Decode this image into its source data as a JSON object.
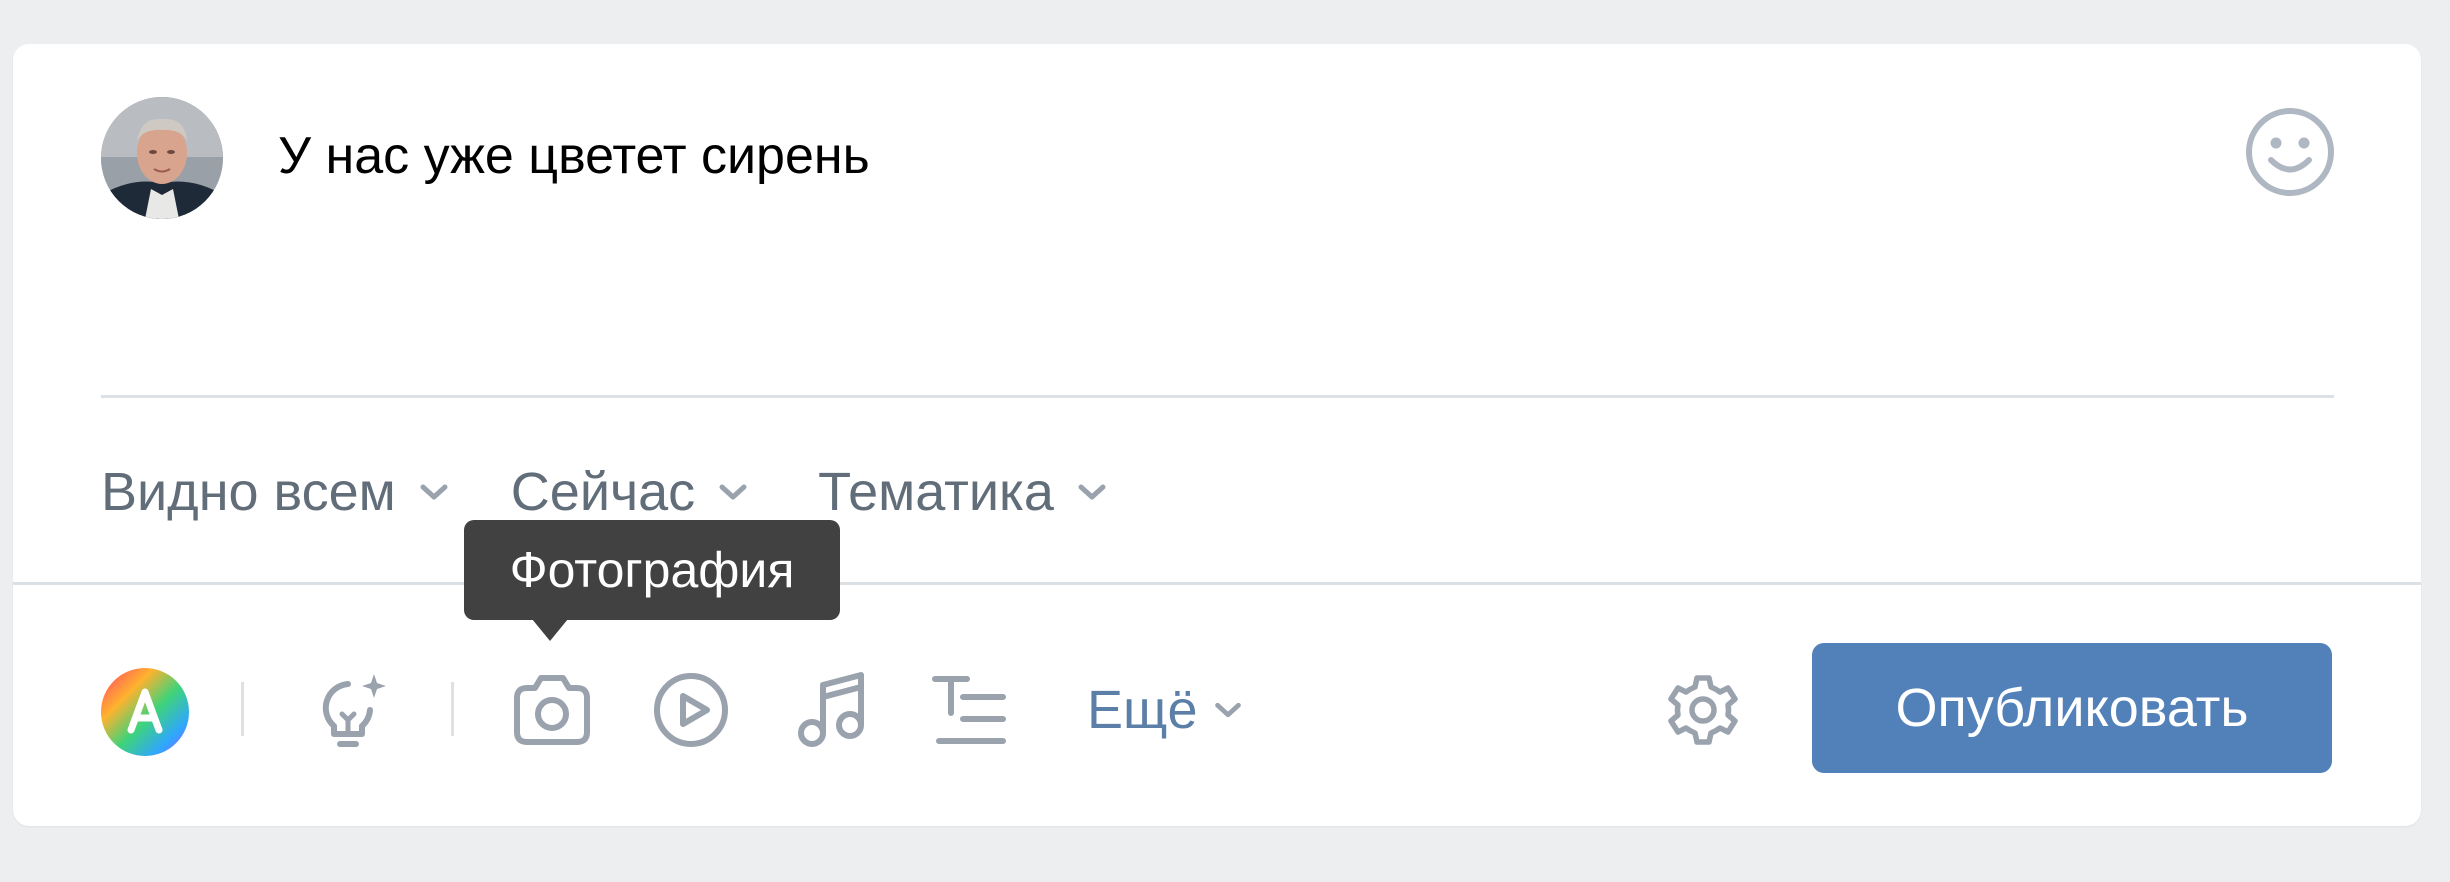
{
  "composer": {
    "post_text": "У нас уже цветет сирень"
  },
  "options": {
    "visibility_label": "Видно всем",
    "time_label": "Сейчас",
    "topic_label": "Тематика"
  },
  "toolbar": {
    "more_label": "Ещё",
    "publish_label": "Опубликовать"
  },
  "tooltip": {
    "text": "Фотография"
  },
  "colors": {
    "accent": "#5181b8",
    "icon": "#99a2ad",
    "page_bg": "#edeef0",
    "tooltip_bg": "#414141"
  },
  "icons": [
    "avatar",
    "smile-icon",
    "chevron-down-icon",
    "art-avatar-icon",
    "lightbulb-sparkle-icon",
    "camera-icon",
    "video-play-icon",
    "music-note-icon",
    "article-icon",
    "gear-icon"
  ]
}
